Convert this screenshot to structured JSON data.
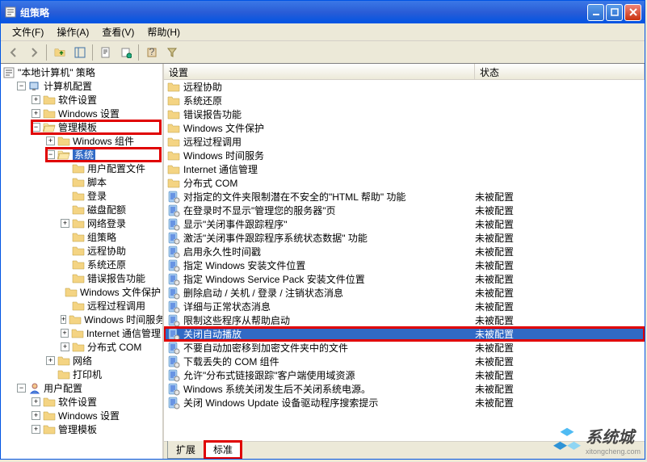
{
  "title": "组策略",
  "menu": {
    "file": "文件(F)",
    "action": "操作(A)",
    "view": "查看(V)",
    "help": "帮助(H)"
  },
  "columns": {
    "name": "设置",
    "state": "状态"
  },
  "tabs": {
    "extended": "扩展",
    "standard": "标准"
  },
  "tree": {
    "root": "\"本地计算机\" 策略",
    "computer": "计算机配置",
    "software": "软件设置",
    "winsettings": "Windows 设置",
    "adminTemplates": "管理模板",
    "winComponents": "Windows 组件",
    "system": "系统",
    "userProfile": "用户配置文件",
    "scripts": "脚本",
    "logon": "登录",
    "diskQuota": "磁盘配额",
    "netLogon": "网络登录",
    "groupPolicy": "组策略",
    "remoteAssist": "远程协助",
    "sysRestore": "系统还原",
    "errorReport": "错误报告功能",
    "winFileProtect": "Windows 文件保护",
    "rpc": "远程过程调用",
    "winTime": "Windows 时间服务",
    "internetComm": "Internet 通信管理",
    "dcom": "分布式 COM",
    "network": "网络",
    "printers": "打印机",
    "userConfig": "用户配置",
    "softSettings2": "软件设置",
    "winSettings2": "Windows 设置",
    "adminTemplates2": "管理模板"
  },
  "list": [
    {
      "type": "folder",
      "name": "远程协助",
      "state": ""
    },
    {
      "type": "folder",
      "name": "系统还原",
      "state": ""
    },
    {
      "type": "folder",
      "name": "错误报告功能",
      "state": ""
    },
    {
      "type": "folder",
      "name": "Windows 文件保护",
      "state": ""
    },
    {
      "type": "folder",
      "name": "远程过程调用",
      "state": ""
    },
    {
      "type": "folder",
      "name": "Windows 时间服务",
      "state": ""
    },
    {
      "type": "folder",
      "name": "Internet 通信管理",
      "state": ""
    },
    {
      "type": "folder",
      "name": "分布式 COM",
      "state": ""
    },
    {
      "type": "policy",
      "name": "对指定的文件夹限制潜在不安全的\"HTML 帮助\" 功能",
      "state": "未被配置"
    },
    {
      "type": "policy",
      "name": "在登录时不显示\"管理您的服务器\"页",
      "state": "未被配置"
    },
    {
      "type": "policy",
      "name": "显示\"关闭事件跟踪程序\"",
      "state": "未被配置"
    },
    {
      "type": "policy",
      "name": "激活\"关闭事件跟踪程序系统状态数据\" 功能",
      "state": "未被配置"
    },
    {
      "type": "policy",
      "name": "启用永久性时间戳",
      "state": "未被配置"
    },
    {
      "type": "policy",
      "name": "指定 Windows 安装文件位置",
      "state": "未被配置"
    },
    {
      "type": "policy",
      "name": "指定 Windows Service Pack 安装文件位置",
      "state": "未被配置"
    },
    {
      "type": "policy",
      "name": "删除启动 / 关机 / 登录 / 注销状态消息",
      "state": "未被配置"
    },
    {
      "type": "policy",
      "name": "详细与正常状态消息",
      "state": "未被配置"
    },
    {
      "type": "policy",
      "name": "限制这些程序从帮助启动",
      "state": "未被配置"
    },
    {
      "type": "policy",
      "name": "关闭自动播放",
      "state": "未被配置",
      "selected": true,
      "highlighted": true
    },
    {
      "type": "policy",
      "name": "不要自动加密移到加密文件夹中的文件",
      "state": "未被配置"
    },
    {
      "type": "policy",
      "name": "下载丢失的 COM 组件",
      "state": "未被配置"
    },
    {
      "type": "policy",
      "name": "允许\"分布式链接跟踪\"客户端使用域资源",
      "state": "未被配置"
    },
    {
      "type": "policy",
      "name": "Windows 系统关闭发生后不关闭系统电源。",
      "state": "未被配置"
    },
    {
      "type": "policy",
      "name": "关闭 Windows Update 设备驱动程序搜索提示",
      "state": "未被配置"
    }
  ],
  "watermark": {
    "brand": "系统城",
    "url": "xitongcheng.com"
  }
}
